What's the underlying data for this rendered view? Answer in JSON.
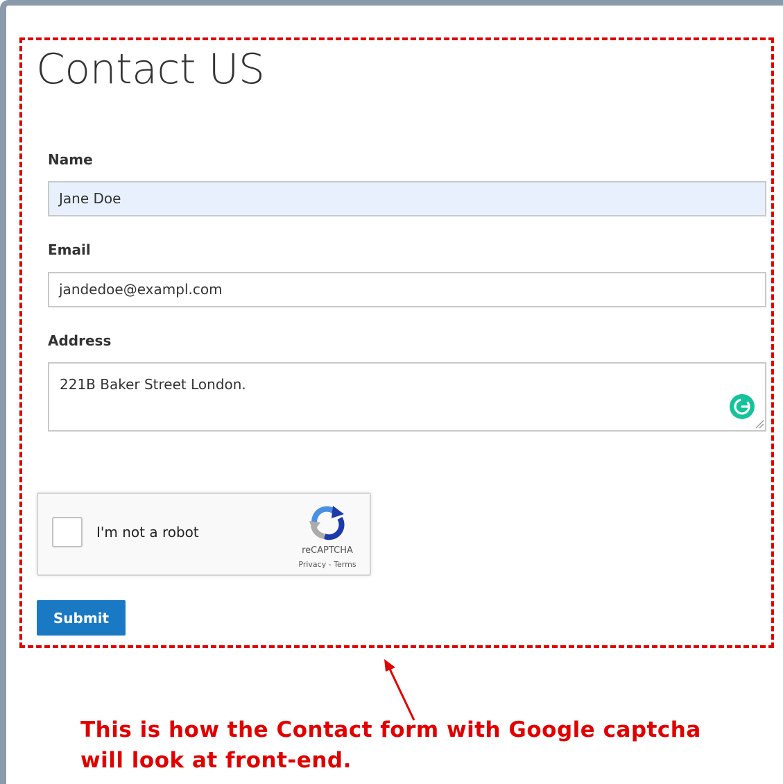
{
  "page": {
    "title": "Contact US"
  },
  "form": {
    "name": {
      "label": "Name",
      "value": "Jane Doe"
    },
    "email": {
      "label": "Email",
      "value": "jandedoe@exampl.com"
    },
    "address": {
      "label": "Address",
      "value": "221B Baker Street London."
    },
    "captcha": {
      "checkbox_label": "I'm not a robot",
      "brand": "reCAPTCHA",
      "privacy_link": "Privacy",
      "separator": " - ",
      "terms_link": "Terms"
    },
    "submit_label": "Submit"
  },
  "annotation": {
    "line1": "This is how the Contact form with Google captcha",
    "line2": "will look at front-end."
  },
  "icons": {
    "grammarly": "grammarly-icon",
    "recaptcha": "recaptcha-logo-icon",
    "arrow": "arrow-up-icon"
  },
  "colors": {
    "annotation_red": "#e10000",
    "submit_blue": "#1979c3",
    "autofill_bg": "#e8f0fe",
    "grammarly_green": "#15c39a"
  }
}
